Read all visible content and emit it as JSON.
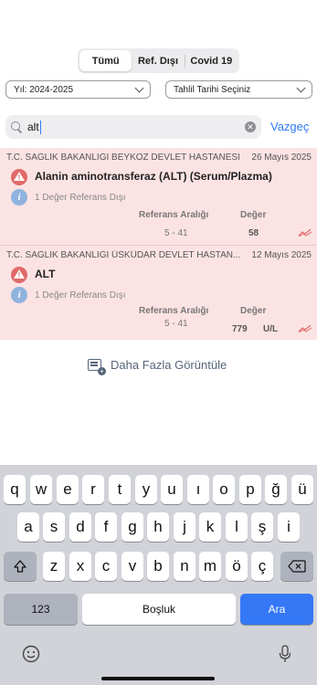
{
  "tabs": [
    {
      "label": "Tümü",
      "active": true
    },
    {
      "label": "Ref. Dışı",
      "active": false
    },
    {
      "label": "Covid 19",
      "active": false
    }
  ],
  "filters": {
    "year": "Yıl: 2024-2025",
    "date": "Tahlil Tarihi Seçiniz"
  },
  "search": {
    "value": "alt",
    "cancel_label": "Vazgeç"
  },
  "results": [
    {
      "hospital": "T.C. SAĞLIK BAKANLIĞI BEYKOZ DEVLET HASTANESİ",
      "date": "26 Mayıs 2025",
      "test": "Alanin aminotransferaz (ALT) (Serum/Plazma)",
      "out_of_range": "1 Değer Referans Dışı",
      "ref_header": "Referans Aralığı",
      "value_header": "Değer",
      "ref_range": "5 - 41",
      "value": "58",
      "unit": ""
    },
    {
      "hospital": "T.C. SAĞLIK BAKANLIĞI ÜSKÜDAR DEVLET HASTAN...",
      "date": "12 Mayıs 2025",
      "test": "ALT",
      "out_of_range": "1 Değer Referans Dışı",
      "ref_header": "Referans Aralığı",
      "value_header": "Değer",
      "ref_range": "5 - 41",
      "value": "779",
      "unit": "U/L"
    }
  ],
  "more_label": "Daha Fazla Görüntüle",
  "keyboard": {
    "row1": [
      "q",
      "w",
      "e",
      "r",
      "t",
      "y",
      "u",
      "ı",
      "o",
      "p",
      "ğ",
      "ü"
    ],
    "row2": [
      "a",
      "s",
      "d",
      "f",
      "g",
      "h",
      "j",
      "k",
      "l",
      "ş",
      "i"
    ],
    "row3": [
      "z",
      "x",
      "c",
      "v",
      "b",
      "n",
      "m",
      "ö",
      "ç"
    ],
    "numbers_label": "123",
    "space_label": "Boşluk",
    "search_label": "Ara"
  },
  "colors": {
    "accent": "#2f7bf6",
    "alert_bg": "#fbe3e4",
    "warning": "#e06a6a"
  }
}
